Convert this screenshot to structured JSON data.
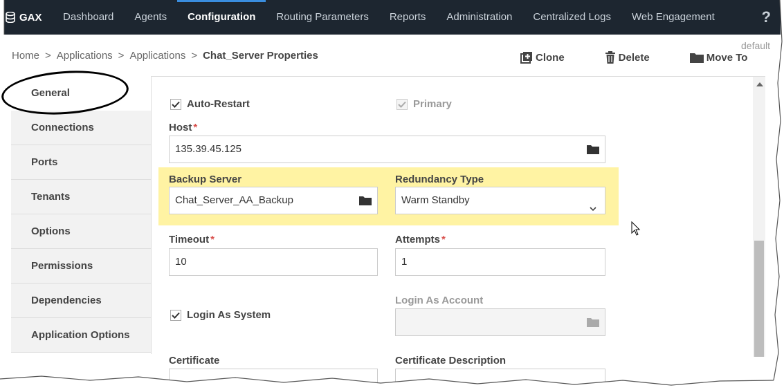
{
  "nav": {
    "logo": "GAX",
    "items": [
      "Dashboard",
      "Agents",
      "Configuration",
      "Routing Parameters",
      "Reports",
      "Administration",
      "Centralized Logs",
      "Web Engagement"
    ],
    "active_index": 2,
    "help": "?"
  },
  "breadcrumb": {
    "items": [
      "Home",
      "Applications",
      "Applications"
    ],
    "current": "Chat_Server Properties",
    "sep": ">"
  },
  "tenant_label": "default",
  "actions": {
    "clone": "Clone",
    "delete": "Delete",
    "move_to": "Move To"
  },
  "tabs": [
    "General",
    "Connections",
    "Ports",
    "Tenants",
    "Options",
    "Permissions",
    "Dependencies",
    "Application Options"
  ],
  "form": {
    "auto_restart": {
      "label": "Auto-Restart",
      "checked": true
    },
    "primary": {
      "label": "Primary",
      "checked": true,
      "disabled": true
    },
    "host": {
      "label": "Host",
      "value": "135.39.45.125"
    },
    "backup_server": {
      "label": "Backup Server",
      "value": "Chat_Server_AA_Backup"
    },
    "redundancy_type": {
      "label": "Redundancy Type",
      "value": "Warm Standby"
    },
    "timeout": {
      "label": "Timeout",
      "value": "10"
    },
    "attempts": {
      "label": "Attempts",
      "value": "1"
    },
    "login_as_system": {
      "label": "Login As System",
      "checked": true
    },
    "login_as_account": {
      "label": "Login As Account",
      "value": ""
    },
    "certificate": {
      "label": "Certificate"
    },
    "certificate_description": {
      "label": "Certificate Description"
    },
    "required_marker": "*"
  },
  "colors": {
    "nav_bg": "#1d2630",
    "highlight": "#fff3a3",
    "required": "#d9534f"
  }
}
